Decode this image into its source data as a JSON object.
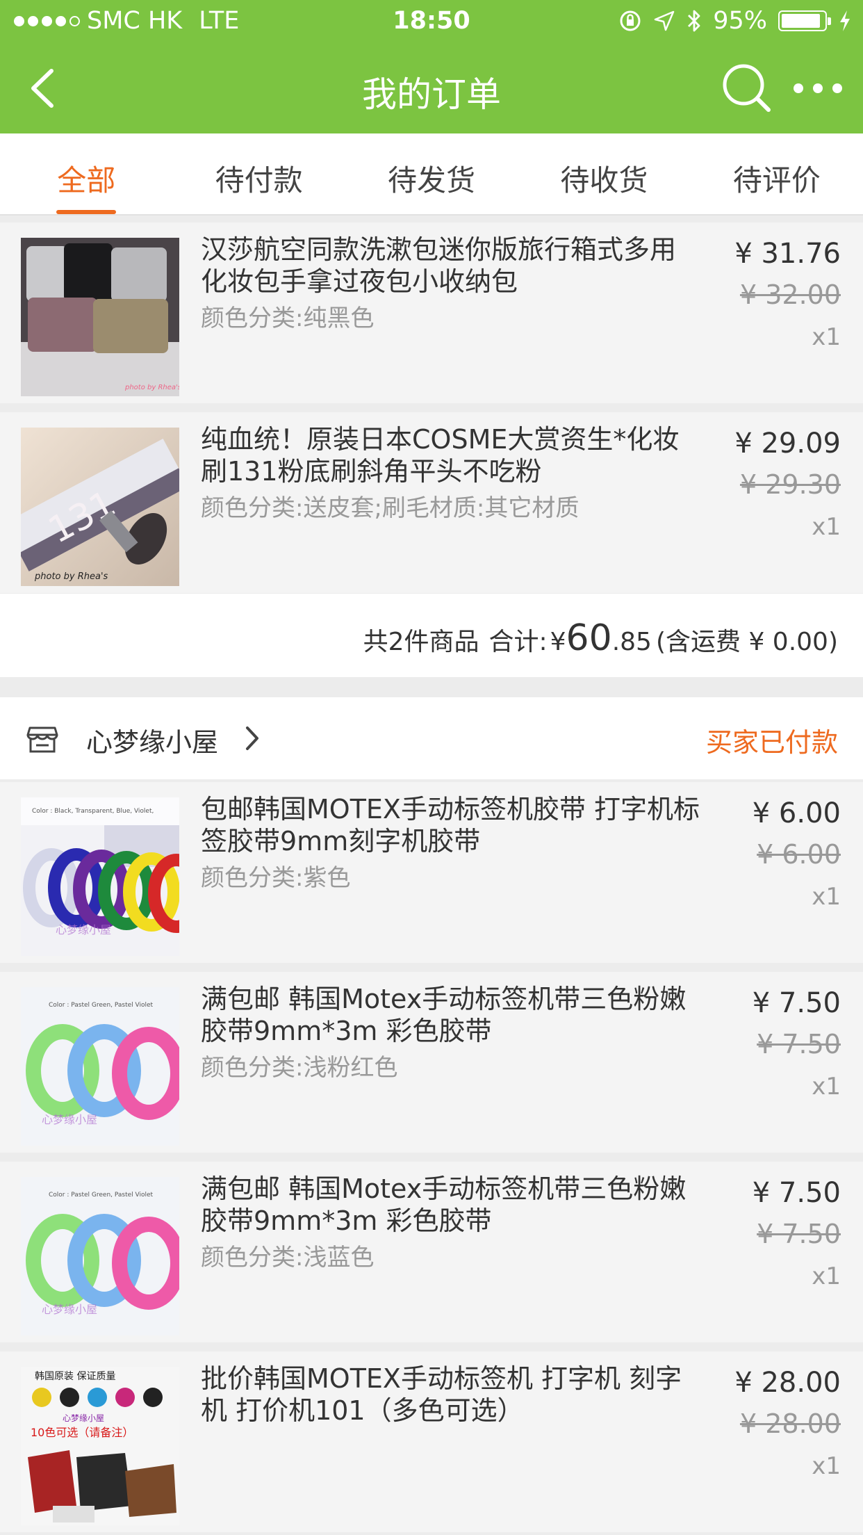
{
  "status_bar": {
    "carrier": "SMC HK",
    "network": "LTE",
    "time": "18:50",
    "battery": "95%",
    "battery_level": 0.95
  },
  "nav": {
    "title": "我的订单"
  },
  "tabs": [
    {
      "label": "全部",
      "active": true
    },
    {
      "label": "待付款",
      "active": false
    },
    {
      "label": "待发货",
      "active": false
    },
    {
      "label": "待收货",
      "active": false
    },
    {
      "label": "待评价",
      "active": false
    }
  ],
  "order1": {
    "items": [
      {
        "title": "汉莎航空同款洗漱包迷你版旅行箱式多用化妆包手拿过夜包小收纳包",
        "sku": "颜色分类:纯黑色",
        "price": "¥ 31.76",
        "original_price": "¥ 32.00",
        "qty": "x1"
      },
      {
        "title": "纯血统！原装日本COSME大赏资生*化妆刷131粉底刷斜角平头不吃粉",
        "sku": "颜色分类:送皮套;刷毛材质:其它材质",
        "price": "¥ 29.09",
        "original_price": "¥ 29.30",
        "qty": "x1"
      }
    ],
    "summary": {
      "count_text": "共2件商品",
      "total_label": "合计:",
      "currency": "¥",
      "total_int": "60",
      "total_dec": ".85",
      "shipping": "(含运费 ¥ 0.00)"
    }
  },
  "order2": {
    "shop_name": "心梦缘小屋",
    "status": "买家已付款",
    "items": [
      {
        "title": "包邮韩国MOTEX手动标签机胶带 打字机标签胶带9mm刻字机胶带",
        "sku": "颜色分类:紫色",
        "price": "¥ 6.00",
        "original_price": "¥ 6.00",
        "qty": "x1"
      },
      {
        "title": "满包邮  韩国Motex手动标签机带三色粉嫩胶带9mm*3m 彩色胶带",
        "sku": "颜色分类:浅粉红色",
        "price": "¥ 7.50",
        "original_price": "¥ 7.50",
        "qty": "x1"
      },
      {
        "title": "满包邮  韩国Motex手动标签机带三色粉嫩胶带9mm*3m 彩色胶带",
        "sku": "颜色分类:浅蓝色",
        "price": "¥ 7.50",
        "original_price": "¥ 7.50",
        "qty": "x1"
      },
      {
        "title": "批价韩国MOTEX手动标签机 打字机 刻字机 打价机101（多色可选）",
        "sku": "",
        "price": "¥ 28.00",
        "original_price": "¥ 28.00",
        "qty": "x1"
      }
    ]
  },
  "thumb_text": {
    "photo_credit": "photo by Rhea's",
    "brush_number": "131",
    "tape_caption_1": "Color : Black, Transparent, Blue, Violet,",
    "tape_caption_2": "Color : Pastel Green, Pastel Violet",
    "shop_watermark": "心梦缘小屋",
    "ad_line_1": "韩国原装  保证质量",
    "ad_line_2": "10色可选（请备注）"
  },
  "colors": {
    "header_green": "#7cc441",
    "accent_orange": "#ee6a1f"
  }
}
